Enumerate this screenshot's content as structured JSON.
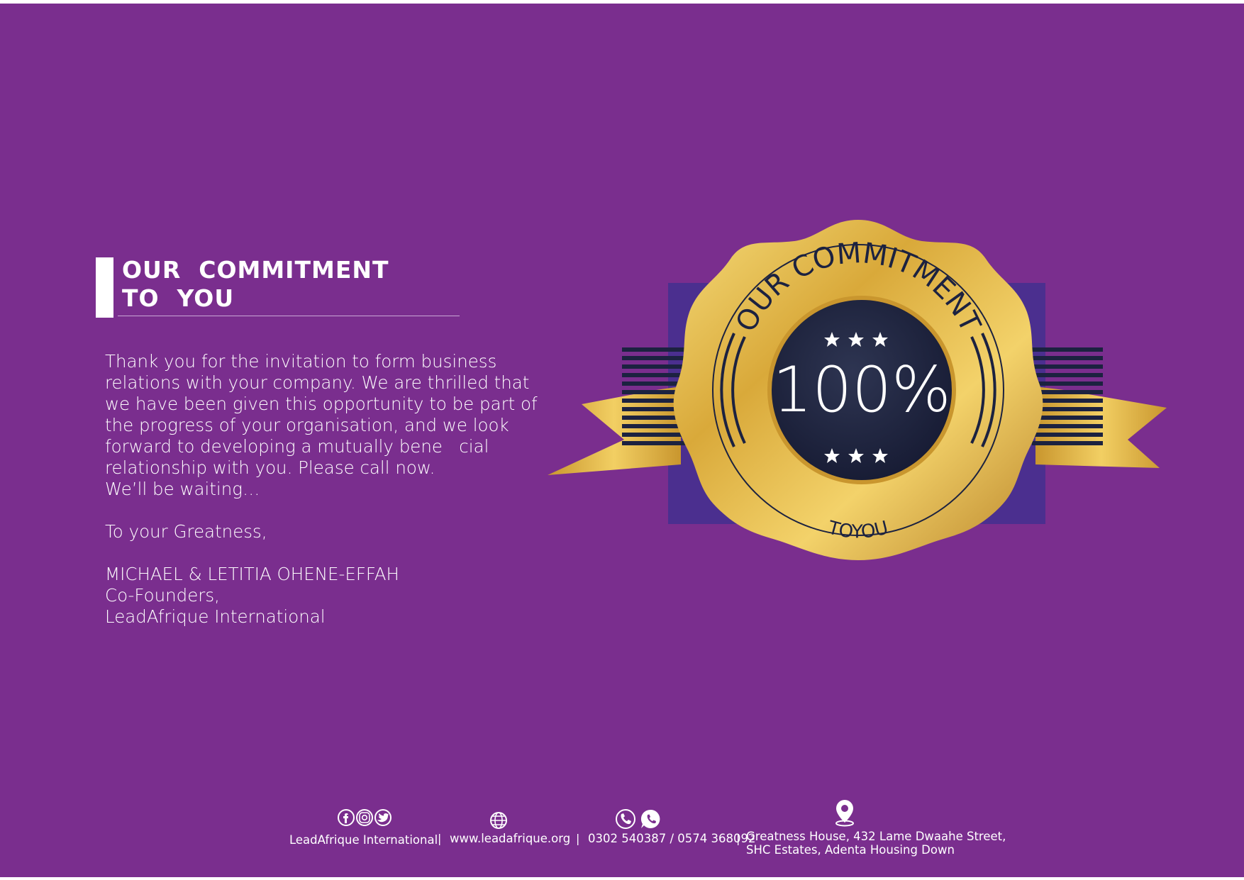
{
  "heading": {
    "line1": "OUR  COMMITMENT",
    "line2": "TO  YOU"
  },
  "body": {
    "lines": [
      "Thank you for the invitation to form business",
      "relations with your company. We are thrilled that",
      "we have been given this opportunity to be part of",
      "the progress of your organisation, and we look",
      "forward to developing a mutually bene   cial",
      "relationship with you. Please call now.",
      "We’ll be waiting…"
    ],
    "salutation": "To your Greatness,",
    "signature": [
      "MICHAEL & LETITIA OHENE-EFFAH",
      "Co-Founders,",
      "LeadAfrique International"
    ]
  },
  "badge": {
    "arc_top": "OUR COMMITMENT",
    "center": "100%",
    "arc_bottom": "TOYOU",
    "colors": {
      "gold": "#d9a93a",
      "navy": "#1c2240",
      "blue_panel": "#46308f"
    }
  },
  "footer": {
    "social_label": "LeadAfrique International",
    "website": "www.leadafrique.org",
    "phones": "0302 540387 / 0574 368092",
    "address_line1": "Greatness House, 432 Lame Dwaahe Street,",
    "address_line2": "SHC Estates, Adenta Housing Down",
    "separator": "|",
    "icons": [
      "facebook-icon",
      "instagram-icon",
      "twitter-icon",
      "globe-icon",
      "phone-icon",
      "whatsapp-icon",
      "location-pin-icon"
    ]
  },
  "colors": {
    "background": "#7a2e8e",
    "text": "#ffffff"
  }
}
